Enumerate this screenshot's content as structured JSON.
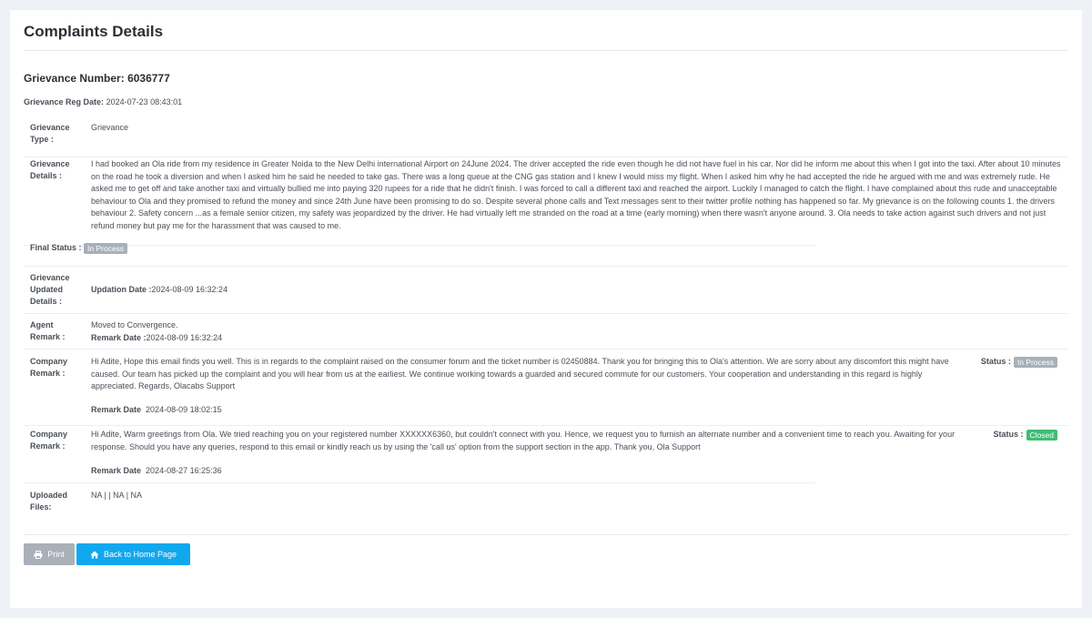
{
  "page": {
    "title": "Complaints Details",
    "grievance_number_label": "Grievance Number:",
    "grievance_number": "6036777",
    "reg_date_label": "Grievance Reg Date:",
    "reg_date": "2024-07-23 08:43:01"
  },
  "details": {
    "type_label_1": "Grievance",
    "type_label_2": "Type :",
    "type_value": "Grievance",
    "details_label_1": "Grievance",
    "details_label_2": "Details :",
    "details_value": "I had booked an Ola ride from my residence in Greater Noida to the New Delhi international Airport on 24June 2024. The driver accepted the ride even though he did not have fuel in his car. Nor did he inform me about this when I got into the taxi. After about 10 minutes on the road he took a diversion and when I asked him he said he needed to take gas. There was a long queue at the CNG gas station and I knew I would miss my flight. When I asked him why he had accepted the ride he argued with me and was extremely rude. He asked me to get off and take another taxi and virtually bullied me into paying 320 rupees for a ride that he didn't finish. I was forced to call a different taxi and reached the airport. Luckily I managed to catch the flight. I have complained about this rude and unacceptable behaviour to Ola and they promised to refund the money and since 24th June have been promising to do so. Despite several phone calls and Text messages sent to their twitter profile nothing has happened so far. My grievance is on the following counts 1. the drivers behaviour 2. Safety concern ...as a female senior citizen, my safety was jeopardized by the driver. He had virtually left me stranded on the road at a time (early morning) when there wasn't anyone around. 3. Ola needs to take action against such drivers and not just refund money but pay me for the harassment that was caused to me.",
    "final_status_label": "Final Status :",
    "final_status": "In Process",
    "updated_label_1": "Grievance",
    "updated_label_2": "Updated",
    "updated_label_3": "Details :",
    "updation_date_label": "Updation Date :",
    "updation_date": "2024-08-09 16:32:24",
    "agent_label_1": "Agent",
    "agent_label_2": "Remark :",
    "agent_remark": "Moved to Convergence.",
    "agent_remark_date_label": "Remark Date :",
    "agent_remark_date": "2024-08-09 16:32:24"
  },
  "company_remarks": [
    {
      "label_1": "Company",
      "label_2": "Remark :",
      "text": "Hi Adite, Hope this email finds you well. This is in regards to the complaint raised on the consumer forum and the ticket number is 02450884. Thank you for bringing this to Ola's attention. We are sorry about any discomfort this might have caused. Our team has picked up the complaint and you will hear from us at the earliest. We continue working towards a guarded and secured commute for our customers. Your cooperation and understanding in this regard is highly appreciated. Regards, Olacabs Support",
      "date_label": "Remark Date",
      "date": "2024-08-09 18:02:15",
      "status_label": "Status :",
      "status": "In Process"
    },
    {
      "label_1": "Company",
      "label_2": "Remark :",
      "text": "Hi Adite, Warm greetings from Ola. We tried reaching you on your registered number XXXXXX6360, but couldn't connect with you. Hence, we request you to furnish an alternate number and a convenient time to reach you. Awaiting for your response. Should you have any queries, respond to this email or kindly reach us by using the 'call us' option from the support section in the app. Thank you, Ola Support",
      "date_label": "Remark Date",
      "date": "2024-08-27 16:25:36",
      "status_label": "Status :",
      "status": "Closed"
    }
  ],
  "files": {
    "label_1": "Uploaded",
    "label_2": "Files:",
    "value": "NA | | NA | NA"
  },
  "actions": {
    "print_label": "Print",
    "home_label": "Back to Home Page"
  },
  "colors": {
    "status_in_process": "#a8b0b9",
    "status_closed": "#3fbd74",
    "primary_button": "#12a8ee",
    "secondary_button": "#a9b0b8"
  },
  "icons": {
    "print": "printer-icon",
    "home": "home-icon"
  }
}
